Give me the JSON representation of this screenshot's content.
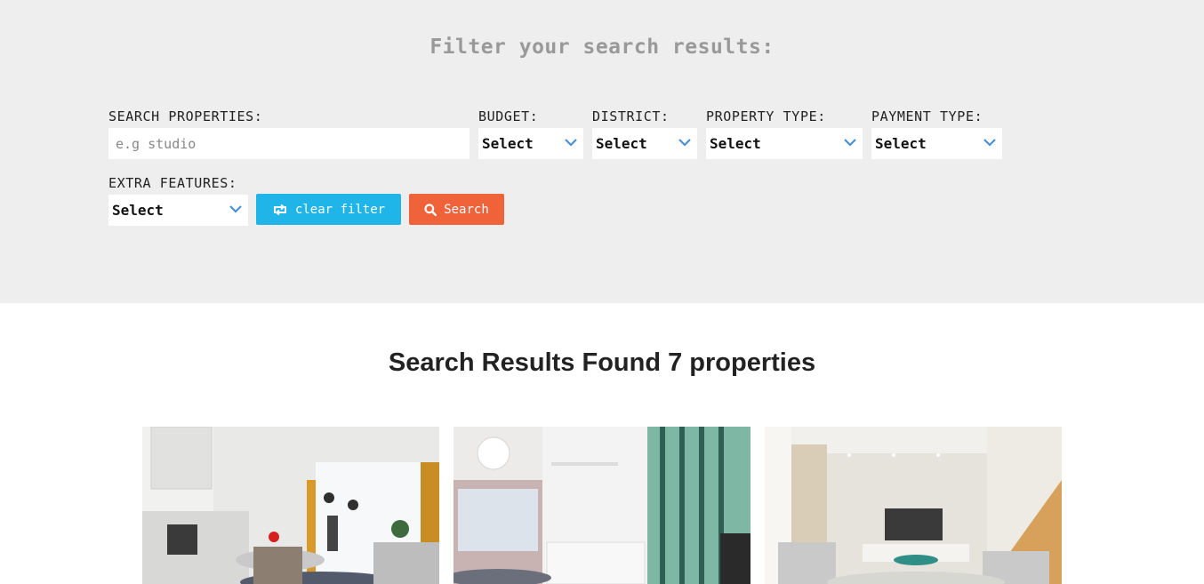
{
  "filters": {
    "title": "Filter your search results:",
    "search": {
      "label": "SEARCH PROPERTIES:",
      "placeholder": "e.g studio",
      "value": ""
    },
    "budget": {
      "label": "BUDGET:",
      "selected": "Select"
    },
    "district": {
      "label": "DISTRICT:",
      "selected": "Select"
    },
    "property_type": {
      "label": "PROPERTY TYPE:",
      "selected": "Select"
    },
    "payment_type": {
      "label": "PAYMENT TYPE:",
      "selected": "Select"
    },
    "extra_features": {
      "label": "EXTRA FEATURES:",
      "selected": "Select"
    },
    "clear_button": {
      "label": "clear filter",
      "icon": "retweet-icon"
    },
    "search_button": {
      "label": "Search",
      "icon": "search-icon"
    }
  },
  "results": {
    "title": "Search Results Found 7 properties"
  },
  "colors": {
    "filter_bg": "#eeeeee",
    "clear_button": "#1fb5e8",
    "search_button": "#f0623a",
    "chevron": "#4a90d9"
  }
}
